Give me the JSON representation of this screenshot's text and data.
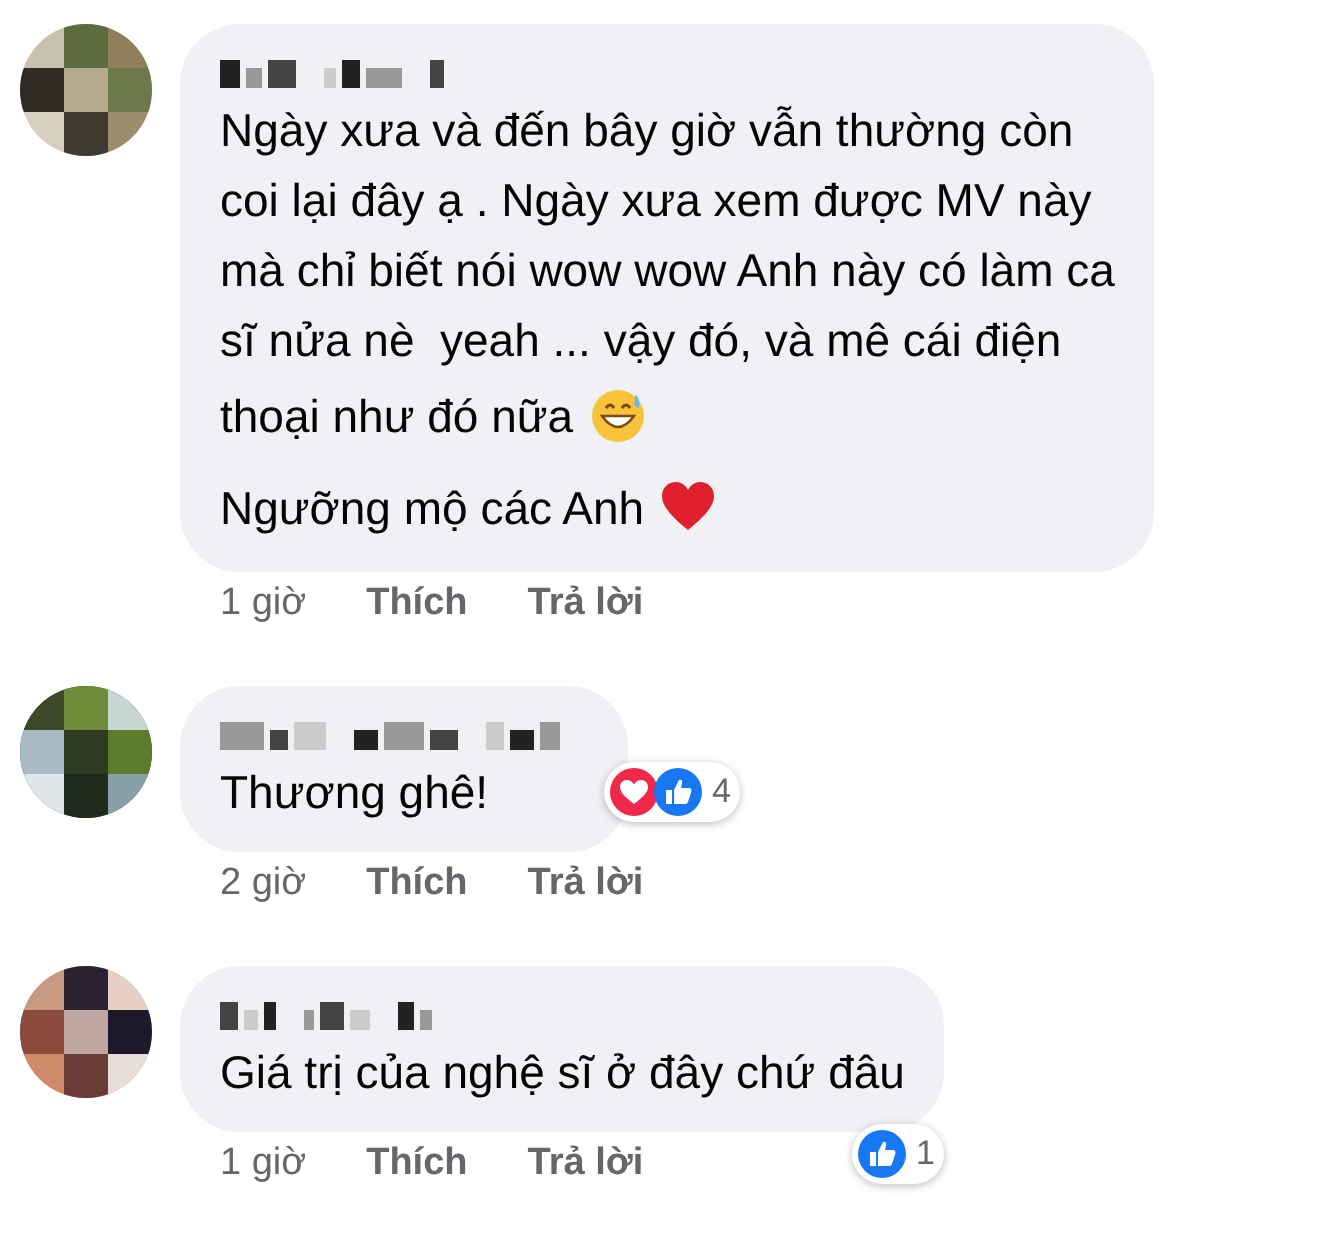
{
  "comments": [
    {
      "paragraphs": [
        {
          "lines": [
            "Ngày xưa và đến bây giờ vẫn thường còn",
            "coi lại đây ạ . Ngày xưa xem được MV này",
            "mà chỉ biết nói wow wow Anh này có làm ca",
            "sĩ nửa nè  yeah ... vậy đó, và mê cái điện",
            "thoại như đó nữa"
          ],
          "emoji": {
            "kind": "sweat_smile"
          }
        },
        {
          "lines": [
            "Ngưỡng mộ các Anh"
          ],
          "emoji": {
            "kind": "heart"
          }
        }
      ],
      "time": "1 giờ",
      "like": "Thích",
      "reply": "Trả lời"
    },
    {
      "paragraphs": [
        {
          "lines": [
            "Thương ghê!"
          ]
        }
      ],
      "time": "2 giờ",
      "like": "Thích",
      "reply": "Trả lời",
      "reactions": {
        "icons": [
          {
            "kind": "love"
          },
          {
            "kind": "like"
          }
        ],
        "count": "4"
      }
    },
    {
      "paragraphs": [
        {
          "lines": [
            "Giá trị của nghệ sĩ ở đây chứ đâu"
          ]
        }
      ],
      "time": "1 giờ",
      "like": "Thích",
      "reply": "Trả lời",
      "reactions": {
        "icons": [
          {
            "kind": "like"
          }
        ],
        "count": "1"
      }
    }
  ]
}
